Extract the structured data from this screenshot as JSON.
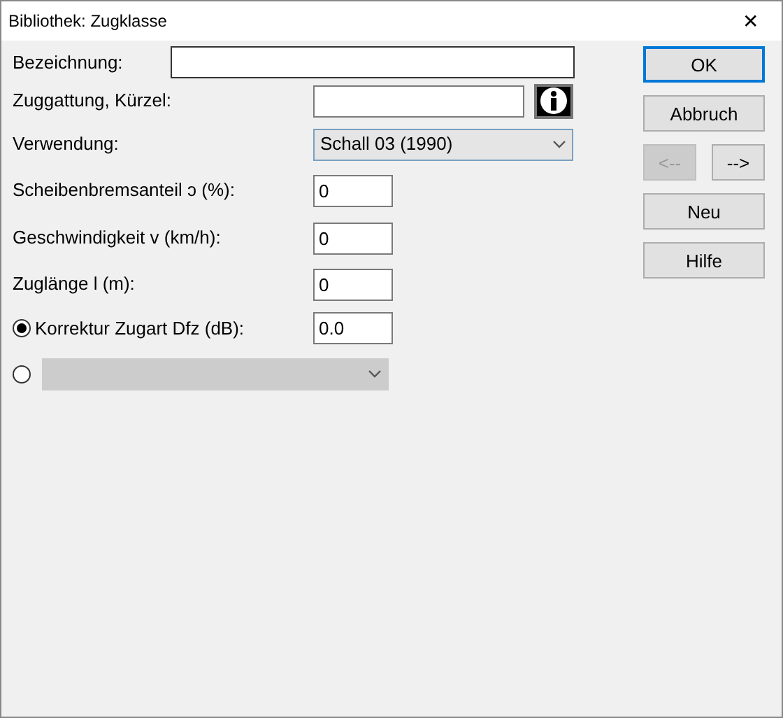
{
  "window": {
    "title": "Bibliothek: Zugklasse",
    "close": "✕"
  },
  "fields": [
    {
      "kind": "text-wide",
      "label": "Bezeichnung:"
    },
    {
      "kind": "text-info",
      "label": "Zuggattung, Kürzel:"
    },
    {
      "kind": "select",
      "label": "Verwendung:",
      "value": "Schall 03 (1990)",
      "disabled": false
    },
    {
      "kind": "number",
      "label": "Scheibenbremsanteil ↄ (%):",
      "value": "0"
    },
    {
      "kind": "number",
      "label": "Geschwindigkeit v (km/h):",
      "value": "0"
    },
    {
      "kind": "number",
      "label": "Zuglänge l (m):",
      "value": "0"
    },
    {
      "kind": "radio-number",
      "label": "Korrektur Zugart Dfz (dB):",
      "value": "0.0",
      "selected": true
    },
    {
      "kind": "radio-select",
      "disabled": true,
      "selected": false
    }
  ],
  "buttons": [
    {
      "label": "OK",
      "default": true,
      "disabled": false,
      "kind": "wide"
    },
    {
      "label": "Abbruch",
      "default": false,
      "disabled": false,
      "kind": "wide"
    },
    {
      "label": "<--",
      "default": false,
      "disabled": true,
      "kind": "half"
    },
    {
      "label": "-->",
      "default": false,
      "disabled": false,
      "kind": "half"
    },
    {
      "label": "Neu",
      "default": false,
      "disabled": false,
      "kind": "wide"
    },
    {
      "label": "Hilfe",
      "default": false,
      "disabled": false,
      "kind": "wide"
    }
  ]
}
